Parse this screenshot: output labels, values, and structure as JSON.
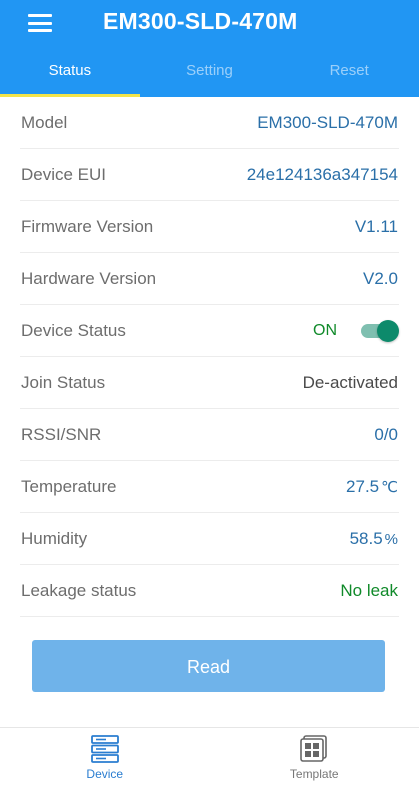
{
  "header": {
    "title": "EM300-SLD-470M",
    "menu_icon": "hamburger-icon",
    "background_color": "#2196f3"
  },
  "tabs": [
    {
      "label": "Status",
      "active": true
    },
    {
      "label": "Setting",
      "active": false
    },
    {
      "label": "Reset",
      "active": false
    }
  ],
  "status": {
    "rows": [
      {
        "label": "Model",
        "value": "EM300-SLD-470M"
      },
      {
        "label": "Device EUI",
        "value": "24e124136a347154"
      },
      {
        "label": "Firmware Version",
        "value": "V1.11"
      },
      {
        "label": "Hardware Version",
        "value": "V2.0"
      },
      {
        "label": "Device Status",
        "value": "ON",
        "toggle_on": true
      },
      {
        "label": "Join Status",
        "value": "De-activated"
      },
      {
        "label": "RSSI/SNR",
        "value": "0/0"
      },
      {
        "label": "Temperature",
        "value": "27.5",
        "unit": "℃"
      },
      {
        "label": "Humidity",
        "value": "58.5",
        "unit": "%"
      },
      {
        "label": "Leakage status",
        "value": "No leak"
      }
    ]
  },
  "read_button": {
    "label": "Read",
    "color": "#6fb3ea"
  },
  "bottom_nav": [
    {
      "label": "Device",
      "icon": "server-rack-icon",
      "active": true
    },
    {
      "label": "Template",
      "icon": "template-grid-icon",
      "active": false
    }
  ]
}
